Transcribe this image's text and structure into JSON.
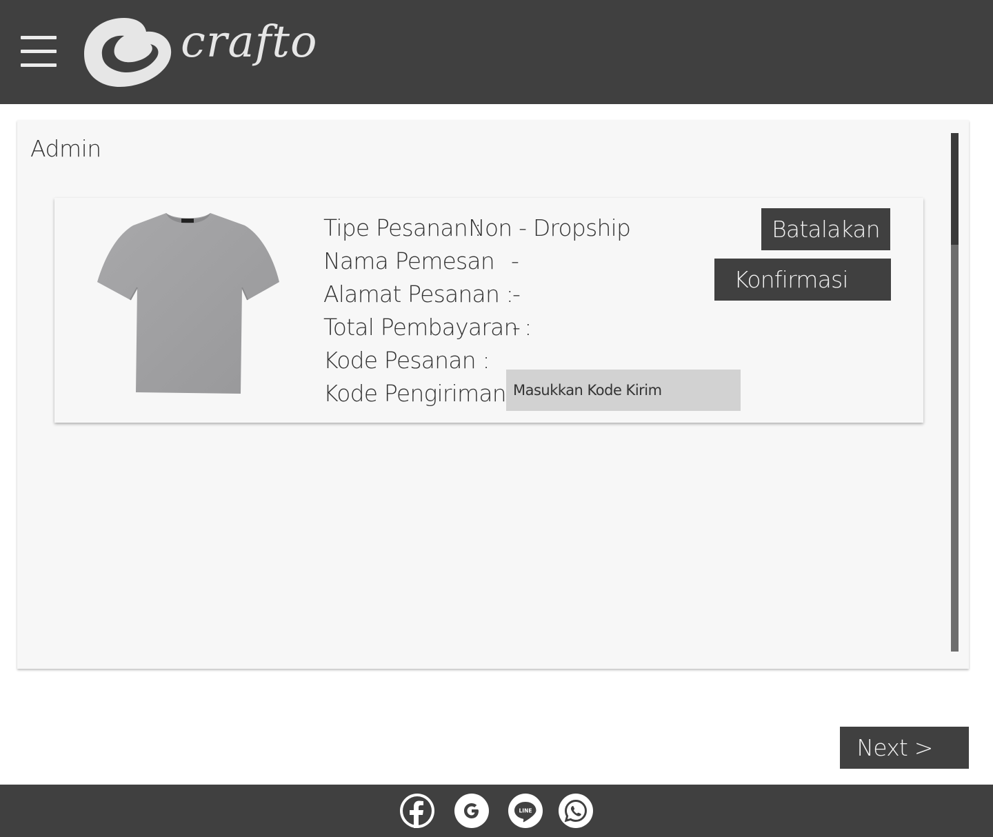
{
  "header": {
    "logo_text": "crafto",
    "menu_icon": "hamburger-menu-icon",
    "colors": {
      "background": "#404040",
      "logo": "#e6e6e6"
    }
  },
  "main": {
    "title": "Admin",
    "order": {
      "image_icon": "grey-tshirt-image",
      "fields": [
        {
          "label": "Tipe Pesanan :",
          "value": "Non - Dropship"
        },
        {
          "label": "Nama Pemesan",
          "value": "-"
        },
        {
          "label": "Alamat Pesanan :",
          "value": "-"
        },
        {
          "label": "Total Pembayaran :",
          "value": "-"
        },
        {
          "label": "Kode Pesanan :",
          "value": ""
        },
        {
          "label": "Kode Pengiriman :",
          "value": ""
        }
      ],
      "shipping_code_input": {
        "placeholder": "Masukkan Kode Kirim",
        "value": ""
      },
      "cancel_label": "Batalakan",
      "confirm_label": "Konfirmasi"
    }
  },
  "pagination": {
    "next_label": "Next >"
  },
  "footer": {
    "social": [
      {
        "name": "facebook-icon",
        "label": "f"
      },
      {
        "name": "google-icon",
        "label": "G"
      },
      {
        "name": "line-icon",
        "label": "LINE"
      },
      {
        "name": "whatsapp-icon",
        "label": ""
      }
    ],
    "colors": {
      "background": "#404040",
      "icon_bg": "#ffffff"
    }
  },
  "colors": {
    "card_bg": "#f7f7f7",
    "button_bg": "#404040",
    "input_bg": "#d2d2d2",
    "scrollbar": "#6e6e6e",
    "scroll_thumb": "#3a3a3a"
  }
}
